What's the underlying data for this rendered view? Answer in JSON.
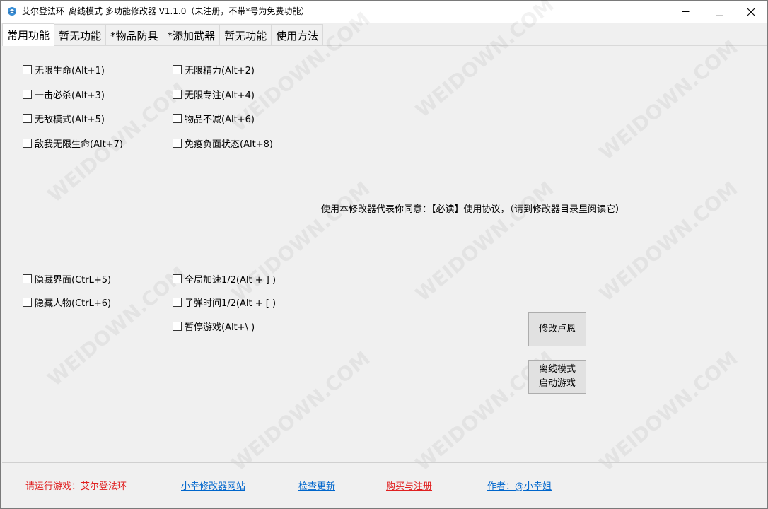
{
  "window": {
    "title": "艾尔登法环_离线模式 多功能修改器  V1.1.0（未注册，不带*号为免费功能）"
  },
  "tabs": [
    {
      "label": "常用功能",
      "active": true
    },
    {
      "label": "暂无功能",
      "active": false
    },
    {
      "label": "*物品防具",
      "active": false
    },
    {
      "label": "*添加武器",
      "active": false
    },
    {
      "label": "暂无功能",
      "active": false
    },
    {
      "label": "使用方法",
      "active": false
    }
  ],
  "options": {
    "infinite_health": {
      "label": "无限生命(Alt+1)",
      "checked": false
    },
    "infinite_stamina": {
      "label": "无限精力(Alt+2)",
      "checked": false
    },
    "one_hit_kill": {
      "label": "一击必杀(Alt+3)",
      "checked": false
    },
    "infinite_focus": {
      "label": "无限专注(Alt+4)",
      "checked": false
    },
    "god_mode": {
      "label": "无敌模式(Alt+5)",
      "checked": false
    },
    "items_no_decrease": {
      "label": "物品不减(Alt+6)",
      "checked": false
    },
    "all_infinite_health": {
      "label": "敌我无限生命(Alt+7)",
      "checked": false
    },
    "immune_debuffs": {
      "label": "免疫负面状态(Alt+8)",
      "checked": false
    },
    "hide_ui": {
      "label": "隐藏界面(CtrL+5)",
      "checked": false
    },
    "global_speed": {
      "label": "全局加速1/2(Alt + ] )",
      "checked": false
    },
    "hide_character": {
      "label": "隐藏人物(CtrL+6)",
      "checked": false
    },
    "bullet_time": {
      "label": "子弹时间1/2(Alt + [ )",
      "checked": false
    },
    "pause_game": {
      "label": "暂停游戏(Alt+\\ )",
      "checked": false
    }
  },
  "notice": "使用本修改器代表你同意：【必读】使用协议，（请到修改器目录里阅读它）",
  "buttons": {
    "modify_runes": "修改卢恩",
    "offline_launch": "离线模式\n启动游戏"
  },
  "footer": {
    "run_game": "请运行游戏：艾尔登法环",
    "website": "小幸修改器网站",
    "check_update": "检查更新",
    "buy_register": "购买与注册",
    "author": "作者：@小幸姐"
  },
  "colors": {
    "run_game": "#e02020",
    "link": "#0066cc",
    "buy_register": "#e02020",
    "title_bar": "#ffffff",
    "panel": "#f0f0f0"
  },
  "watermark": "WEIDOWN.COM"
}
